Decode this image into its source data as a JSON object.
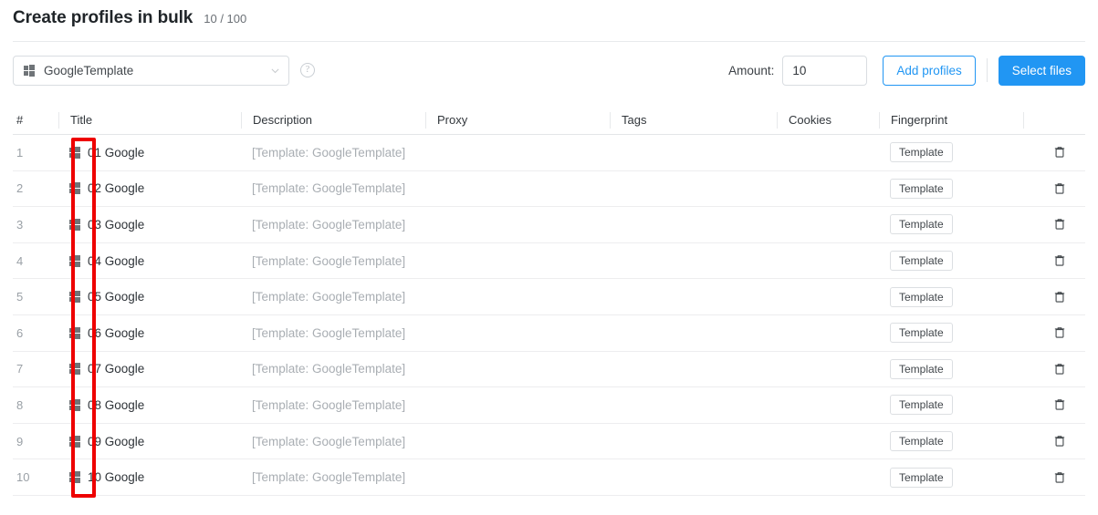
{
  "header": {
    "title": "Create profiles in bulk",
    "counter": "10 / 100"
  },
  "toolbar": {
    "template_icon": "windows-logo-icon",
    "template_value": "GoogleTemplate",
    "chevron_icon": "chevron-down-icon",
    "help_icon": "help-circle-icon",
    "help_symbol": "?",
    "amount_label": "Amount:",
    "amount_value": "10",
    "add_profiles_label": "Add profiles",
    "select_files_label": "Select files"
  },
  "colors": {
    "accent_blue": "#2196f3",
    "annotation_red": "#ee0000",
    "muted_text": "#a9aeb3",
    "index_text": "#9aa0a6"
  },
  "table": {
    "columns": [
      "#",
      "Title",
      "Description",
      "Proxy",
      "Tags",
      "Cookies",
      "Fingerprint",
      ""
    ],
    "fingerprint_label": "Template",
    "delete_icon": "trash-icon",
    "profile_icon": "windows-logo-icon",
    "rows": [
      {
        "index": "1",
        "title": "01 Google",
        "description": "[Template: GoogleTemplate]",
        "proxy": "",
        "tags": "",
        "cookies": "",
        "fingerprint": "Template"
      },
      {
        "index": "2",
        "title": "02 Google",
        "description": "[Template: GoogleTemplate]",
        "proxy": "",
        "tags": "",
        "cookies": "",
        "fingerprint": "Template"
      },
      {
        "index": "3",
        "title": "03 Google",
        "description": "[Template: GoogleTemplate]",
        "proxy": "",
        "tags": "",
        "cookies": "",
        "fingerprint": "Template"
      },
      {
        "index": "4",
        "title": "04 Google",
        "description": "[Template: GoogleTemplate]",
        "proxy": "",
        "tags": "",
        "cookies": "",
        "fingerprint": "Template"
      },
      {
        "index": "5",
        "title": "05 Google",
        "description": "[Template: GoogleTemplate]",
        "proxy": "",
        "tags": "",
        "cookies": "",
        "fingerprint": "Template"
      },
      {
        "index": "6",
        "title": "06 Google",
        "description": "[Template: GoogleTemplate]",
        "proxy": "",
        "tags": "",
        "cookies": "",
        "fingerprint": "Template"
      },
      {
        "index": "7",
        "title": "07 Google",
        "description": "[Template: GoogleTemplate]",
        "proxy": "",
        "tags": "",
        "cookies": "",
        "fingerprint": "Template"
      },
      {
        "index": "8",
        "title": "08 Google",
        "description": "[Template: GoogleTemplate]",
        "proxy": "",
        "tags": "",
        "cookies": "",
        "fingerprint": "Template"
      },
      {
        "index": "9",
        "title": "09 Google",
        "description": "[Template: GoogleTemplate]",
        "proxy": "",
        "tags": "",
        "cookies": "",
        "fingerprint": "Template"
      },
      {
        "index": "10",
        "title": "10 Google",
        "description": "[Template: GoogleTemplate]",
        "proxy": "",
        "tags": "",
        "cookies": "",
        "fingerprint": "Template"
      }
    ]
  },
  "annotation": {
    "shape": "red-rectangle-highlight"
  }
}
